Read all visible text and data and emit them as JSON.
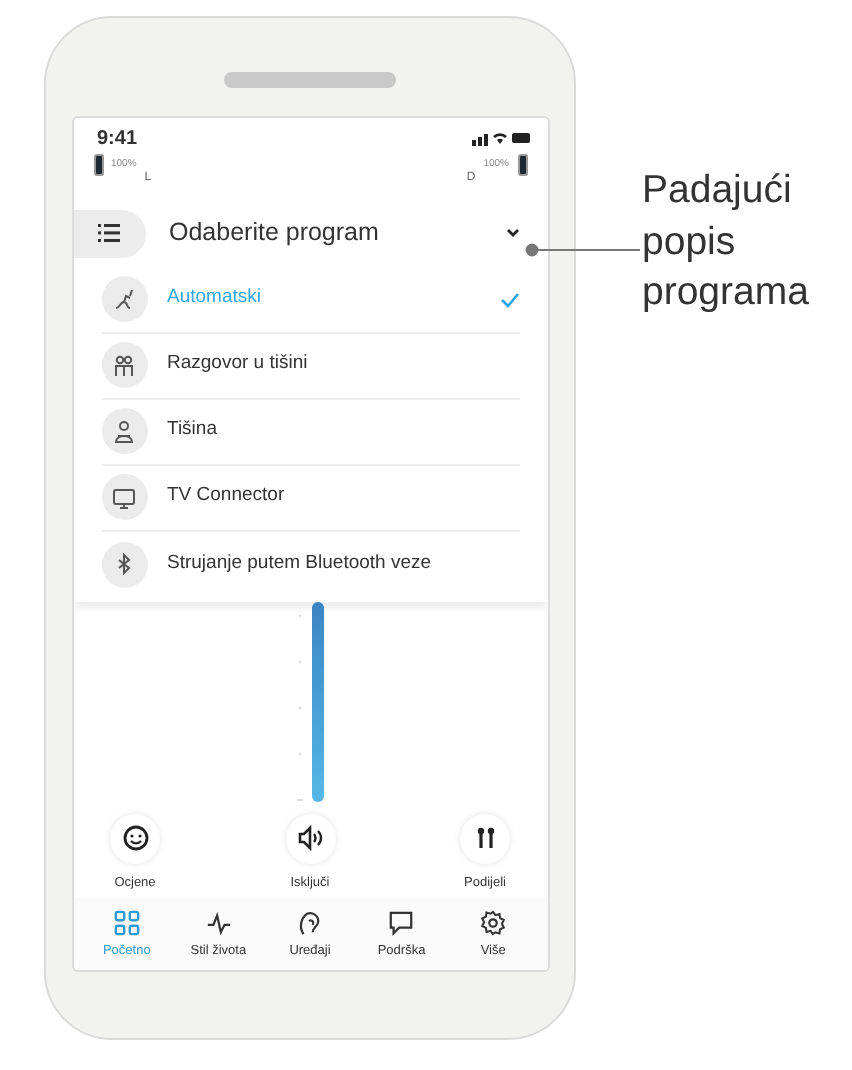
{
  "status_bar": {
    "time": "9:41"
  },
  "hearing_aids": {
    "left": {
      "percent": "100%",
      "side": "L"
    },
    "right": {
      "side": "D",
      "percent": "100%"
    }
  },
  "program_dropdown": {
    "title": "Odaberite program",
    "expanded": true,
    "items": [
      {
        "label": "Automatski",
        "selected": true
      },
      {
        "label": "Razgovor u tišini",
        "selected": false
      },
      {
        "label": "Tišina",
        "selected": false
      },
      {
        "label": "TV Connector",
        "selected": false
      },
      {
        "label": "Strujanje putem Bluetooth veze",
        "selected": false
      }
    ]
  },
  "volume": {
    "level": 1
  },
  "actions": [
    {
      "label": "Ocjene"
    },
    {
      "label": "Isključi"
    },
    {
      "label": "Podijeli"
    }
  ],
  "tabs": [
    {
      "label": "Početno",
      "selected": true
    },
    {
      "label": "Stil života",
      "selected": false
    },
    {
      "label": "Uređaji",
      "selected": false
    },
    {
      "label": "Podrška",
      "selected": false
    },
    {
      "label": "Više",
      "selected": false
    }
  ],
  "callout": {
    "text": "Padajući popis programa"
  }
}
